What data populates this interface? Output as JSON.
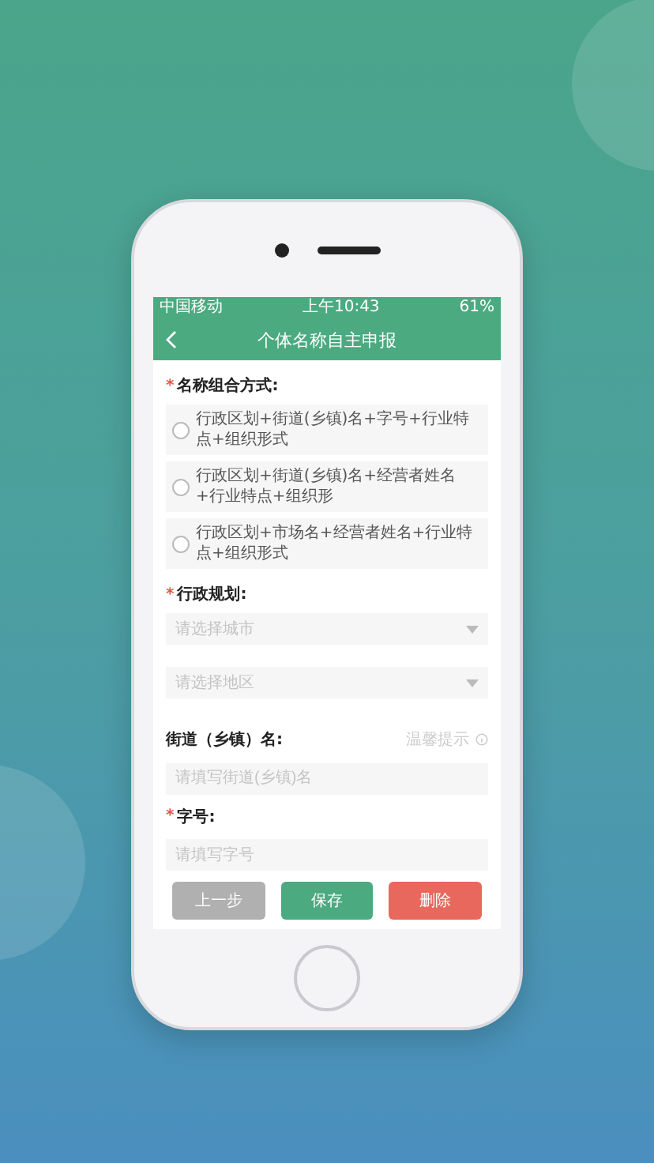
{
  "status_bar": {
    "carrier": "中国移动",
    "time": "上午10:43",
    "battery": "61%"
  },
  "nav": {
    "title": "个体名称自主申报"
  },
  "sections": [
    {
      "kind": "radios",
      "mark": "*",
      "label": "名称组合方式:",
      "options": [
        {
          "text": "行政区划+街道(乡镇)名+字号+行业特点+组织形式",
          "selected": false
        },
        {
          "text": "行政区划+街道(乡镇)名+经营者姓名+行业特点+组织形",
          "selected": false
        },
        {
          "text": "行政区划+市场名+经营者姓名+行业特点+组织形式",
          "selected": false
        }
      ]
    },
    {
      "kind": "selects",
      "mark": "*",
      "label": "行政规划:",
      "fields": [
        {
          "placeholder": "请选择城市"
        },
        {
          "placeholder": "请选择地区"
        }
      ]
    },
    {
      "kind": "input",
      "label": "街道（乡镇）名:",
      "hint": "温馨提示",
      "placeholder": "请填写街道(乡镇)名"
    },
    {
      "kind": "input",
      "mark": "*",
      "label": "字号:",
      "placeholder": "请填写字号"
    }
  ],
  "buttons": [
    {
      "label": "上一步",
      "kind": "back"
    },
    {
      "label": "保存",
      "kind": "save"
    },
    {
      "label": "删除",
      "kind": "delete"
    }
  ]
}
